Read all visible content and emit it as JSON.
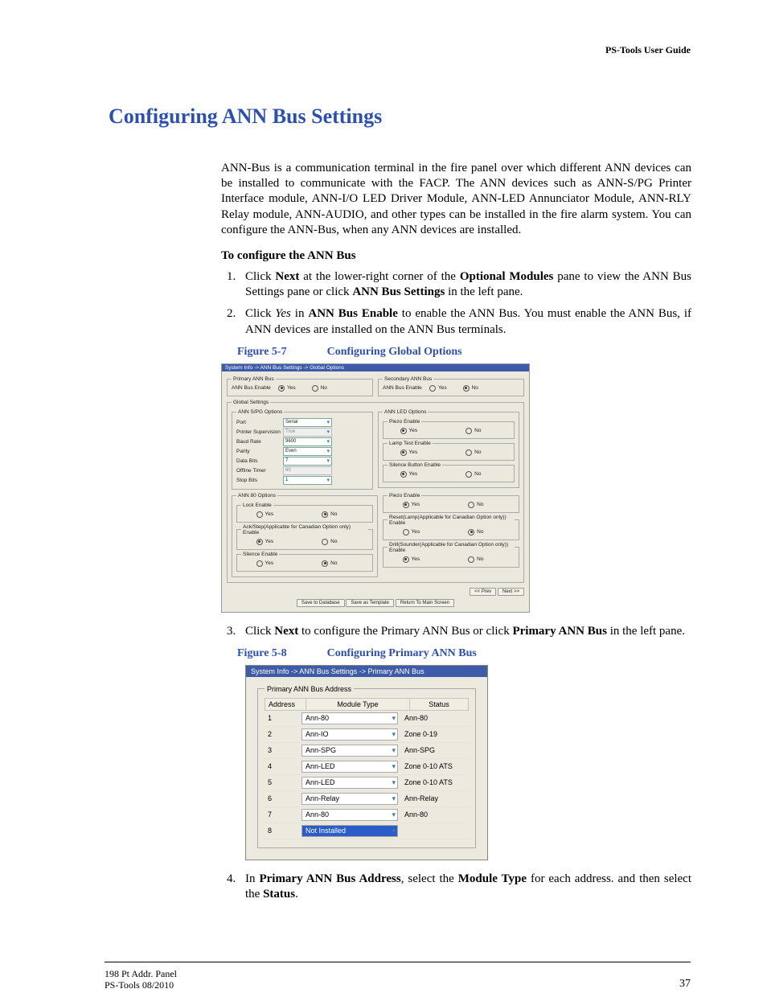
{
  "header": {
    "doc_title": "PS-Tools User Guide"
  },
  "title": "Configuring ANN Bus Settings",
  "intro": "ANN-Bus is a communication terminal in the fire panel over which different ANN devices can be installed to communicate with the FACP. The ANN devices such as ANN-S/PG Printer Interface module, ANN-I/O LED Driver Module, ANN-LED Annunciator Module, ANN-RLY Relay module, ANN-AUDIO, and other types can be installed in the fire alarm system. You can configure the ANN-Bus, when any ANN devices are installed.",
  "subheading": "To configure the ANN Bus",
  "steps": {
    "s1a": "Click ",
    "s1b": "Next",
    "s1c": " at the lower-right corner of the ",
    "s1d": "Optional Modules",
    "s1e": " pane to view the ANN Bus Settings pane or click ",
    "s1f": "ANN Bus Settings",
    "s1g": " in the left pane.",
    "s2a": "Click ",
    "s2b": "Yes",
    "s2c": " in ",
    "s2d": "ANN Bus Enable",
    "s2e": " to enable the ANN Bus. You must enable the ANN Bus, if ANN devices are installed on the ANN Bus terminals.",
    "s3a": "Click ",
    "s3b": "Next",
    "s3c": " to configure the Primary ANN Bus or click ",
    "s3d": "Primary ANN Bus",
    "s3e": " in the left pane.",
    "s4a": "In ",
    "s4b": "Primary ANN Bus Address",
    "s4c": ", select the ",
    "s4d": "Module Type",
    "s4e": " for each address. and then select the ",
    "s4f": "Status",
    "s4g": "."
  },
  "fig7": {
    "num": "Figure 5-7",
    "title": "Configuring Global Options",
    "breadcrumb": "System Info -> ANN Bus Settings -> Global Options",
    "primary_legend": "Primary ANN Bus",
    "secondary_legend": "Secondary ANN Bus",
    "enable_label": "ANN Bus Enable",
    "yes": "Yes",
    "no": "No",
    "global_legend": "Global Settings",
    "spg_legend": "ANN S/PG Options",
    "port_l": "Port",
    "port_v": "Serial",
    "psup_l": "Printer Supervision",
    "psup_v": "True",
    "baud_l": "Baud Rate",
    "baud_v": "9600",
    "parity_l": "Parity",
    "parity_v": "Even",
    "databits_l": "Data Bits",
    "databits_v": "7",
    "offline_l": "Offline Timer",
    "offline_v": "60",
    "stopbits_l": "Stop Bits",
    "stopbits_v": "1",
    "led_legend": "ANN LED Options",
    "piezo_l": "Piezo Enable",
    "lamp_l": "Lamp Test Enable",
    "silbtn_l": "Silence Button Enable",
    "ann80_legend": "ANN 80 Options",
    "lock_l": "Lock Enable",
    "ack_l": "Ack/Step(Applicable for Canadian Option only) Enable",
    "silence_l": "Silence Enable",
    "piezo2_l": "Piezo Enable",
    "reset_l": "Reset(Lamp(Applicable for Canadian Option only)) Enable",
    "drill_l": "Drill(Sounder(Applicable for Canadian Option only)) Enable",
    "prev_btn": "<< Prev",
    "next_btn": "Next >>",
    "save_db": "Save to Database",
    "save_tpl": "Save as Template",
    "return_main": "Return To Main Screen"
  },
  "fig8": {
    "num": "Figure 5-8",
    "title": "Configuring Primary ANN Bus",
    "breadcrumb": "System Info -> ANN Bus Settings -> Primary ANN Bus",
    "legend": "Primary ANN Bus Address",
    "h_addr": "Address",
    "h_mod": "Module Type",
    "h_stat": "Status",
    "rows": [
      {
        "a": "1",
        "m": "Ann-80",
        "s": "Ann-80",
        "sel": false
      },
      {
        "a": "2",
        "m": "Ann-IO",
        "s": "Zone 0-19",
        "sel": false
      },
      {
        "a": "3",
        "m": "Ann-SPG",
        "s": "Ann-SPG",
        "sel": false
      },
      {
        "a": "4",
        "m": "Ann-LED",
        "s": "Zone 0-10 ATS",
        "sel": false
      },
      {
        "a": "5",
        "m": "Ann-LED",
        "s": "Zone 0-10 ATS",
        "sel": false
      },
      {
        "a": "6",
        "m": "Ann-Relay",
        "s": "Ann-Relay",
        "sel": false
      },
      {
        "a": "7",
        "m": "Ann-80",
        "s": "Ann-80",
        "sel": false
      },
      {
        "a": "8",
        "m": "Not Installed",
        "s": "",
        "sel": true
      }
    ]
  },
  "footer": {
    "l1": "198 Pt Addr. Panel",
    "l2": "PS-Tools  08/2010",
    "page": "37"
  }
}
